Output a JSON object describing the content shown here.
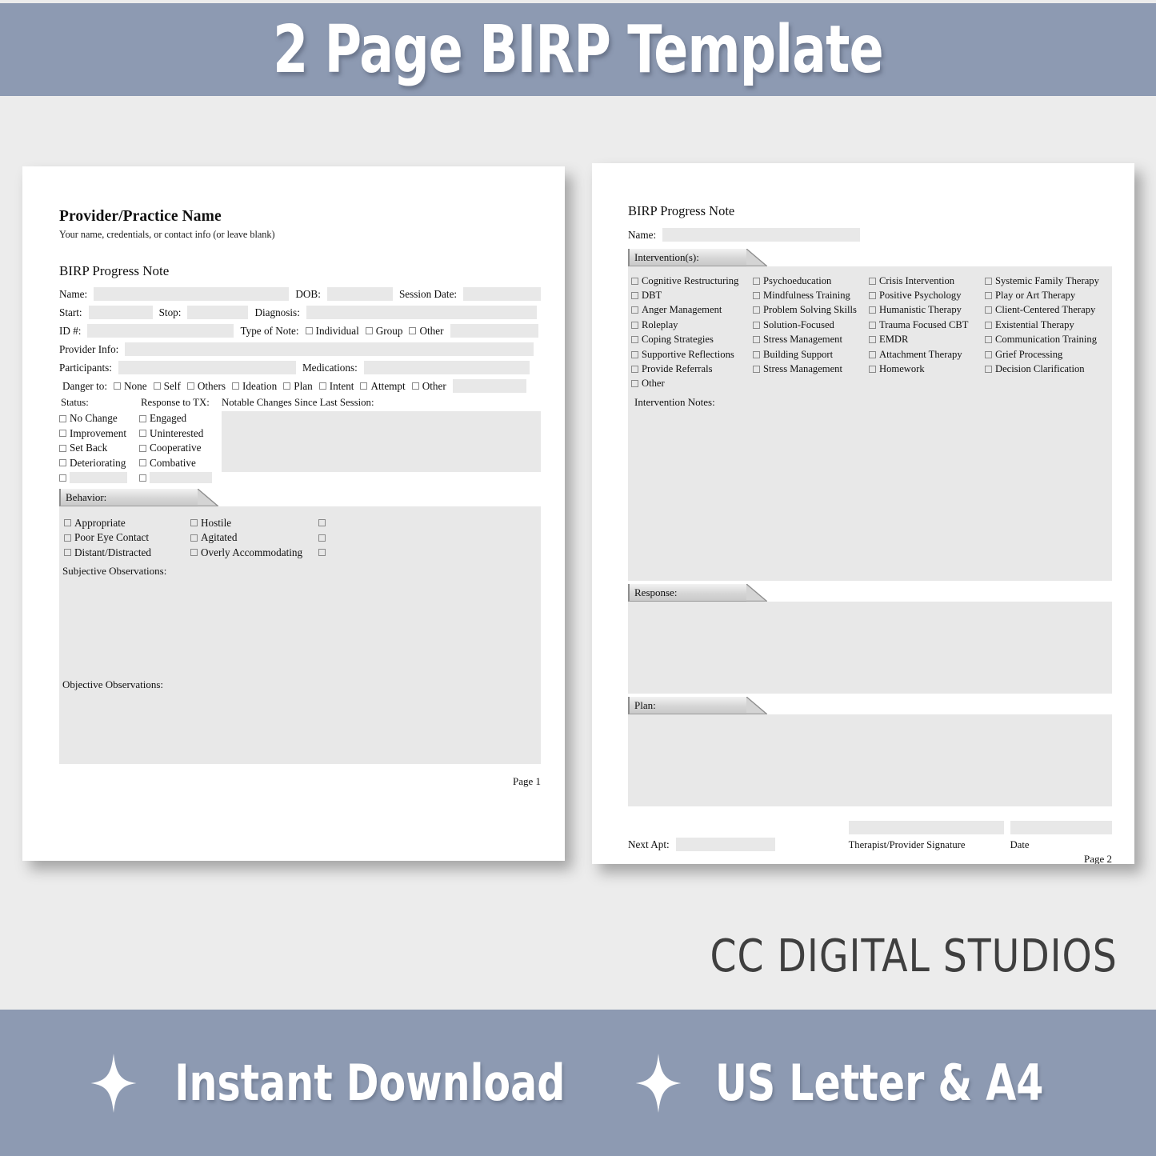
{
  "top_banner": {
    "title": "2 Page BIRP Template"
  },
  "brand": {
    "name": "CC DIGITAL STUDIOS"
  },
  "bottom_banner": {
    "items": [
      {
        "icon": "sparkle-icon",
        "label": "Instant Download"
      },
      {
        "icon": "sparkle-icon",
        "label": "US Letter & A4"
      }
    ]
  },
  "colors": {
    "banner_bg": "#8d9ab2",
    "page_bg": "#ececec",
    "field_fill": "#e8e8e8",
    "tab_fill": "#d6d6d6",
    "text": "#111111"
  },
  "page1": {
    "provider_title": "Provider/Practice Name",
    "provider_subtitle": "Your name, credentials, or contact info (or leave blank)",
    "note_title": "BIRP Progress Note",
    "labels": {
      "name": "Name:",
      "dob": "DOB:",
      "session_date": "Session Date:",
      "start": "Start:",
      "stop": "Stop:",
      "diagnosis": "Diagnosis:",
      "id": "ID #:",
      "type_of_note": "Type of Note:",
      "provider_info": "Provider Info:",
      "participants": "Participants:",
      "medications": "Medications:",
      "danger_to": "Danger to:",
      "status": "Status:",
      "response_to_tx": "Response to TX:",
      "notable_changes": "Notable Changes Since Last Session:",
      "subjective": "Subjective Observations:",
      "objective": "Objective Observations:"
    },
    "type_of_note_options": [
      "Individual",
      "Group",
      "Other"
    ],
    "danger_to_options": [
      "None",
      "Self",
      "Others",
      "Ideation",
      "Plan",
      "Intent",
      "Attempt",
      "Other"
    ],
    "status_options": [
      "No Change",
      "Improvement",
      "Set Back",
      "Deteriorating"
    ],
    "response_options": [
      "Engaged",
      "Uninterested",
      "Cooperative",
      "Combative"
    ],
    "behavior": {
      "tab_label": "Behavior:",
      "col1": [
        "Appropriate",
        "Poor Eye Contact",
        "Distant/Distracted"
      ],
      "col2": [
        "Hostile",
        "Agitated",
        "Overly Accommodating"
      ],
      "col3_blank_count": 3
    },
    "page_number": "Page 1"
  },
  "page2": {
    "note_title": "BIRP Progress Note",
    "labels": {
      "name": "Name:",
      "intervention_notes": "Intervention Notes:",
      "next_apt": "Next Apt:",
      "signature": "Therapist/Provider Signature",
      "date": "Date"
    },
    "sections": {
      "interventions": "Intervention(s):",
      "response": "Response:",
      "plan": "Plan:"
    },
    "interventions": {
      "col1": [
        "Cognitive Restructuring",
        "DBT",
        "Anger Management",
        "Roleplay",
        "Coping Strategies",
        "Supportive Reflections",
        "Provide Referrals",
        "Other"
      ],
      "col2": [
        "Psychoeducation",
        "Mindfulness Training",
        "Problem Solving Skills",
        "Solution-Focused",
        "Stress Management",
        "Building Support",
        "Stress Management"
      ],
      "col3": [
        "Crisis Intervention",
        "Positive Psychology",
        "Humanistic Therapy",
        "Trauma Focused CBT",
        "EMDR",
        "Attachment Therapy",
        "Homework"
      ],
      "col4": [
        "Systemic Family Therapy",
        "Play or Art Therapy",
        "Client-Centered Therapy",
        "Existential Therapy",
        "Communication Training",
        "Grief Processing",
        "Decision Clarification"
      ]
    },
    "page_number": "Page 2"
  }
}
